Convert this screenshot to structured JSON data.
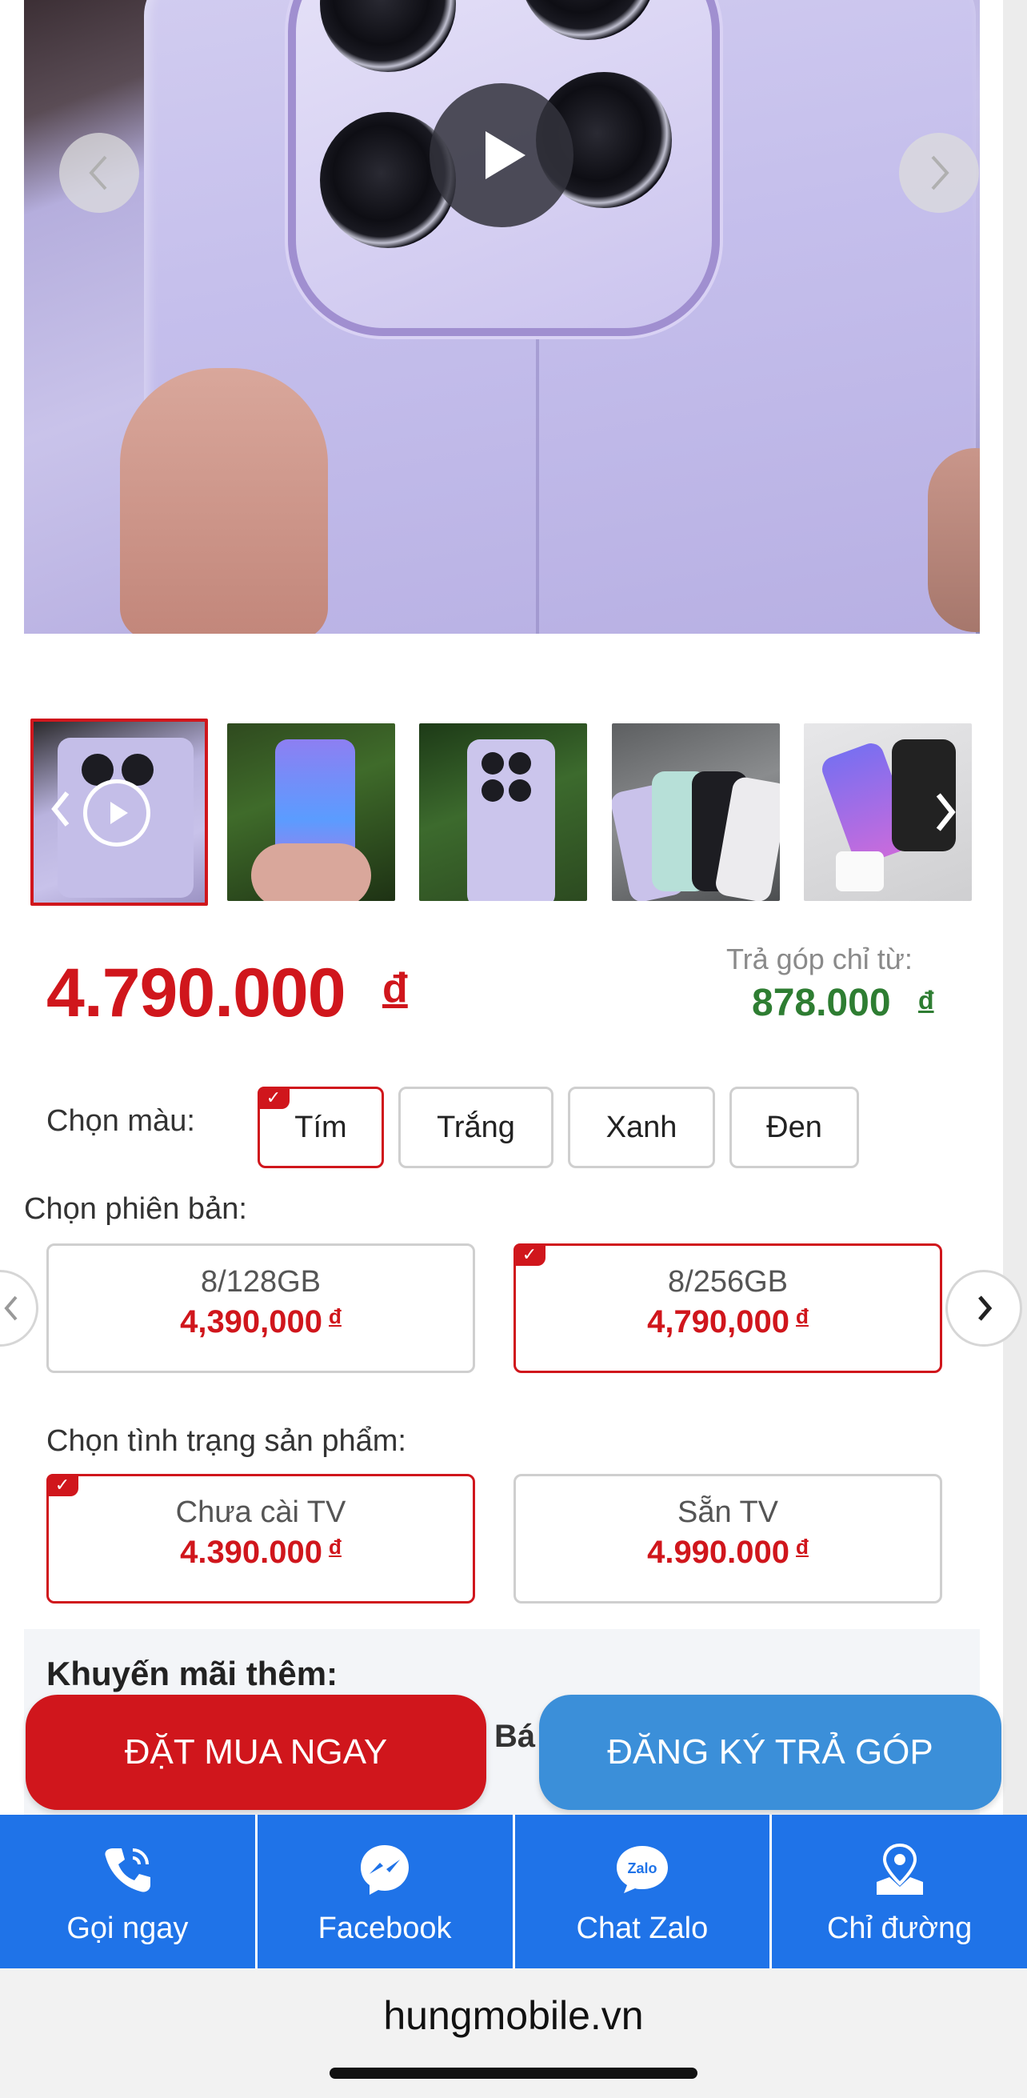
{
  "product": {
    "price": "4.790.000",
    "currency": "đ",
    "installment_label": "Trả góp chỉ từ:",
    "installment_price": "878.000",
    "installment_currency": "đ"
  },
  "color": {
    "label": "Chọn màu:",
    "options": [
      "Tím",
      "Trắng",
      "Xanh",
      "Đen"
    ],
    "selected": "Tím"
  },
  "version": {
    "label": "Chọn phiên bản:",
    "options": [
      {
        "name": "8/128GB",
        "price": "4,390,000",
        "currency": "đ"
      },
      {
        "name": "8/256GB",
        "price": "4,790,000",
        "currency": "đ"
      }
    ],
    "selected": "8/256GB"
  },
  "condition": {
    "label": "Chọn tình trạng sản phẩm:",
    "options": [
      {
        "name": "Chưa cài TV",
        "price": "4.390.000",
        "currency": "đ"
      },
      {
        "name": "Sẵn TV",
        "price": "4.990.000",
        "currency": "đ"
      }
    ],
    "selected": "Chưa cài TV"
  },
  "promo": {
    "title": "Khuyến mãi thêm:",
    "partial_text": "Bá"
  },
  "actions": {
    "order": "ĐẶT MUA NGAY",
    "install": "ĐĂNG KÝ TRẢ GÓP"
  },
  "bottom_nav": [
    {
      "label": "Gọi ngay",
      "icon": "phone-icon"
    },
    {
      "label": "Facebook",
      "icon": "messenger-icon"
    },
    {
      "label": "Chat Zalo",
      "icon": "zalo-icon"
    },
    {
      "label": "Chỉ đường",
      "icon": "map-pin-icon"
    }
  ],
  "zalo_icon_text": "Zalo",
  "browser": {
    "url": "hungmobile.vn"
  },
  "colors": {
    "accent_red": "#d0161c",
    "installment_green": "#2e7d32",
    "nav_blue": "#1f73e8",
    "install_button_blue": "#3b8fd9"
  }
}
